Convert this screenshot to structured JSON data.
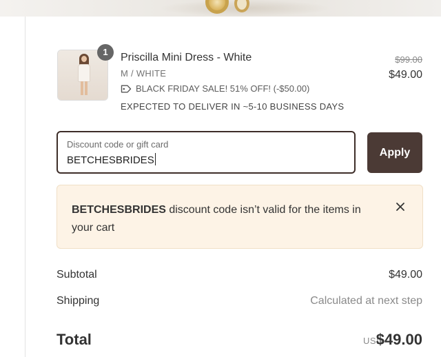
{
  "product": {
    "name": "Priscilla Mini Dress - White",
    "variant": "M / WHITE",
    "discount_note": "BLACK FRIDAY SALE! 51% OFF! (-$50.00)",
    "delivery": "EXPECTED TO DELIVER IN ~5-10 BUSINESS DAYS",
    "compare_price": "$99.00",
    "price": "$49.00",
    "quantity": "1",
    "tag_icon": "tag-icon"
  },
  "discount": {
    "label": "Discount code or gift card",
    "value": "BETCHESBRIDES",
    "apply_label": "Apply"
  },
  "error": {
    "code": "BETCHESBRIDES",
    "message": " discount code isn’t valid for the items in your cart",
    "close_icon": "close-icon"
  },
  "totals": {
    "subtotal_label": "Subtotal",
    "subtotal_value": "$49.00",
    "shipping_label": "Shipping",
    "shipping_value": "Calculated at next step",
    "total_label": "Total",
    "currency": "USD",
    "total_value": "$49.00"
  },
  "colors": {
    "apply_bg": "#4b3a35",
    "field_border": "#3d2d28",
    "error_bg": "#fdf3e6"
  }
}
